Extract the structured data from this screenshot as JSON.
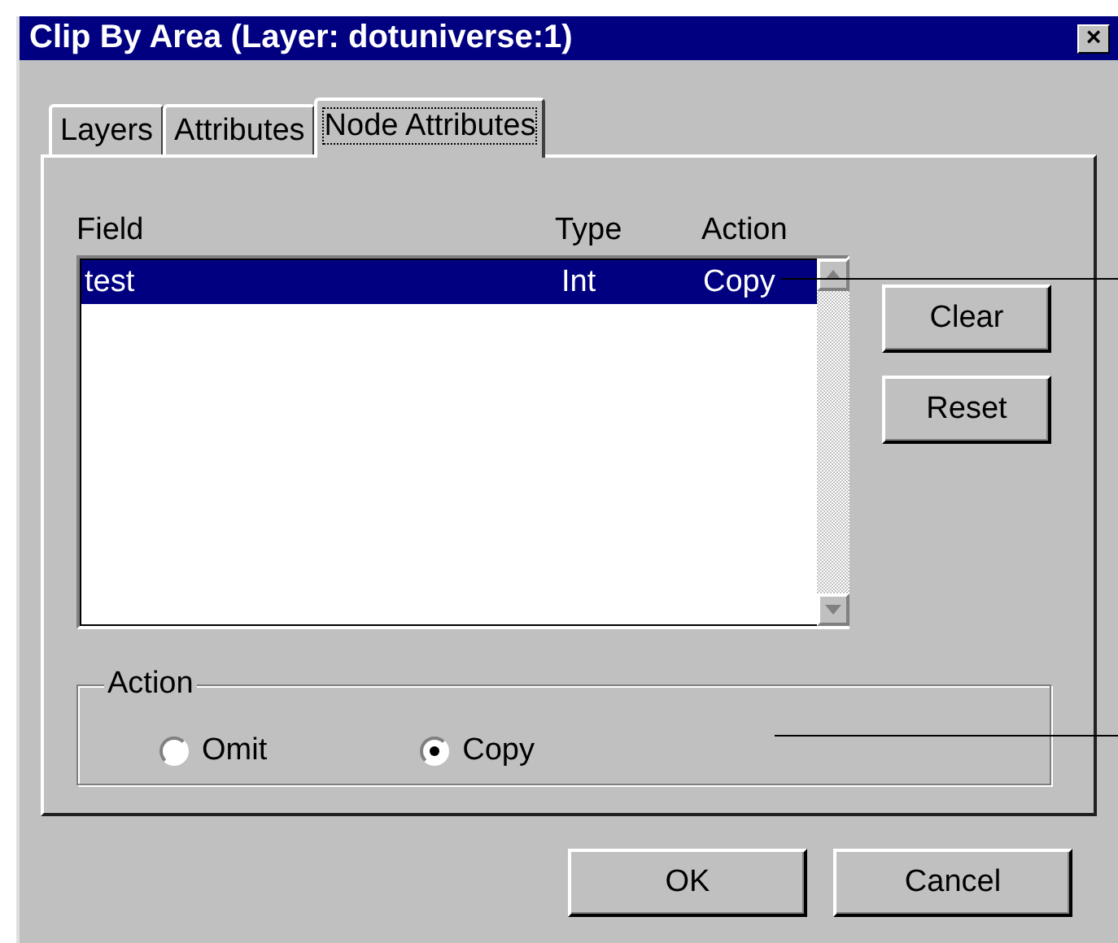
{
  "window": {
    "title": "Clip By Area (Layer: dotuniverse:1)",
    "close": "×"
  },
  "tabs": [
    {
      "label": "Layers",
      "selected": false
    },
    {
      "label": "Attributes",
      "selected": false
    },
    {
      "label": "Node Attributes",
      "selected": true
    }
  ],
  "list": {
    "columns": [
      "Field",
      "Type",
      "Action"
    ],
    "rows": [
      {
        "cells": [
          "test",
          "Int",
          "Copy"
        ],
        "selected": true
      }
    ]
  },
  "side_buttons": [
    "Clear",
    "Reset"
  ],
  "action_group": {
    "title": "Action",
    "options": [
      {
        "label": "Omit",
        "selected": false
      },
      {
        "label": "Copy",
        "selected": true
      }
    ]
  },
  "buttons": [
    "OK",
    "Cancel"
  ]
}
